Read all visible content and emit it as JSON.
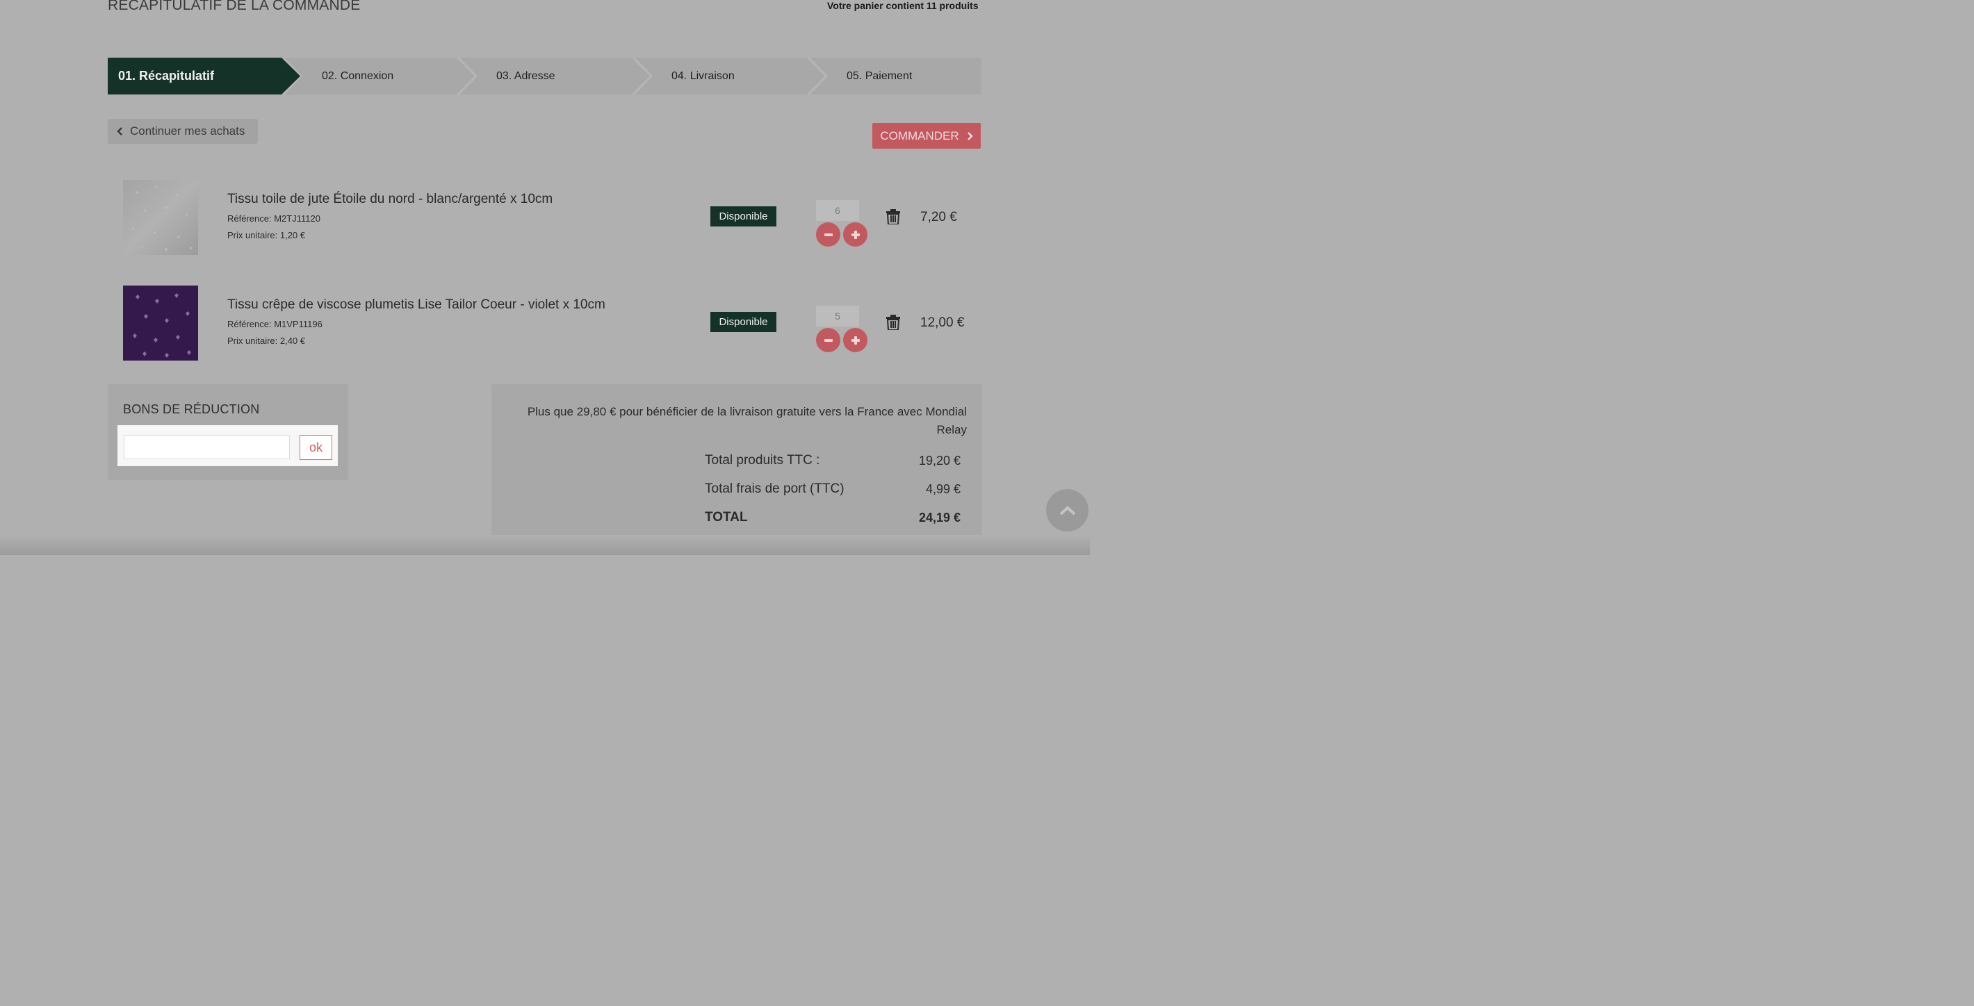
{
  "header": {
    "title": "RÉCAPITULATIF DE LA COMMANDE",
    "cart_count": "Votre panier contient 11 produits"
  },
  "steps": [
    {
      "label": "01. Récapitulatif",
      "active": true
    },
    {
      "label": "02. Connexion",
      "active": false
    },
    {
      "label": "03. Adresse",
      "active": false
    },
    {
      "label": "04. Livraison",
      "active": false
    },
    {
      "label": "05. Paiement",
      "active": false
    }
  ],
  "actions": {
    "continue_label": "Continuer mes achats",
    "order_label": "COMMANDER"
  },
  "products": [
    {
      "name": "Tissu toile de jute Étoile du nord - blanc/argenté x 10cm",
      "reference": "Référence: M2TJ11120",
      "unit_price": "Prix unitaire: 1,20 €",
      "availability": "Disponible",
      "quantity": "6",
      "total": "7,20 €",
      "image": "fabric-white-silver-stars"
    },
    {
      "name": "Tissu crêpe de viscose plumetis Lise Tailor Coeur - violet x 10cm",
      "reference": "Référence: M1VP11196",
      "unit_price": "Prix unitaire: 2,40 €",
      "availability": "Disponible",
      "quantity": "5",
      "total": "12,00 €",
      "image": "fabric-violet-hearts"
    }
  ],
  "voucher": {
    "title": "BONS DE RÉDUCTION",
    "input_value": "",
    "submit_label": "ok"
  },
  "totals": {
    "shipping_message": "Plus que 29,80 € pour bénéficier de la livraison gratuite vers la France avec Mondial Relay",
    "products_label": "Total produits TTC :",
    "products_value": "19,20 €",
    "shipping_label": "Total frais de port (TTC)",
    "shipping_value": "4,99 €",
    "total_label": "TOTAL",
    "total_value": "24,19 €"
  },
  "colors": {
    "accent_dark_green": "#143228",
    "accent_red": "#c2595f",
    "overlay_gray": "#b0b0b0"
  },
  "icons": [
    "chevron-left-icon",
    "chevron-right-icon",
    "minus-icon",
    "plus-icon",
    "trash-icon",
    "chevron-up-icon"
  ]
}
